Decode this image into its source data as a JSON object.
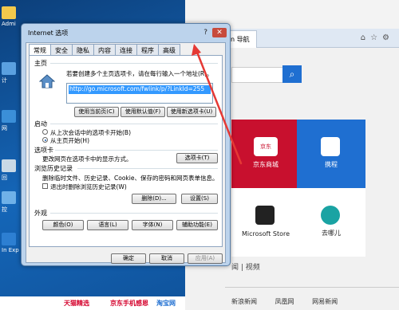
{
  "desktop": {
    "icons": [
      {
        "label": "Admi"
      },
      {
        "label": "计"
      },
      {
        "label": "网"
      },
      {
        "label": "回"
      },
      {
        "label": "控"
      },
      {
        "label": "In Exp"
      }
    ]
  },
  "browser": {
    "tab_title": "n 导航",
    "tiles": [
      {
        "label": "京东商城",
        "badge": "京东"
      },
      {
        "label": "携程"
      },
      {
        "label": "Microsoft Store"
      },
      {
        "label": "去哪儿"
      }
    ],
    "news_header": "闻 | 视频",
    "news_items": [
      "新浪新闻",
      "凤凰网",
      "网易新闻"
    ],
    "bottom_links": [
      "天猫精选",
      "京东手机感恩",
      "淘宝网"
    ]
  },
  "dialog": {
    "title": "Internet 选项",
    "help": "?",
    "close": "✕",
    "tabs": [
      "常规",
      "安全",
      "隐私",
      "内容",
      "连接",
      "程序",
      "高级"
    ],
    "homepage": {
      "heading": "主页",
      "desc": "若要创建多个主页选项卡，请在每行输入一个地址(R)。",
      "url": "http://go.microsoft.com/fwlink/p/?LinkId=255",
      "btn_current": "使用当前页(C)",
      "btn_default": "使用默认值(F)",
      "btn_newtab": "使用新选项卡(U)"
    },
    "startup": {
      "heading": "启动",
      "opt_lastsession": "从上次会话中的选项卡开始(B)",
      "opt_homepage": "从主页开始(H)"
    },
    "tabs_section": {
      "heading": "选项卡",
      "desc": "更改网页在选项卡中的显示方式。",
      "button": "选项卡(T)"
    },
    "history": {
      "heading": "浏览历史记录",
      "desc": "删除临时文件、历史记录、Cookie、保存的密码和网页表单信息。",
      "checkbox": "退出时删除浏览历史记录(W)",
      "btn_delete": "删除(D)...",
      "btn_settings": "设置(S)"
    },
    "appearance": {
      "heading": "外观",
      "btn_colors": "颜色(O)",
      "btn_languages": "语言(L)",
      "btn_fonts": "字体(N)",
      "btn_accessibility": "辅助功能(E)"
    },
    "footer": {
      "ok": "确定",
      "cancel": "取消",
      "apply": "应用(A)"
    }
  },
  "colors": {
    "annotation_arrow": "#e53935",
    "selection": "#3399ff"
  }
}
